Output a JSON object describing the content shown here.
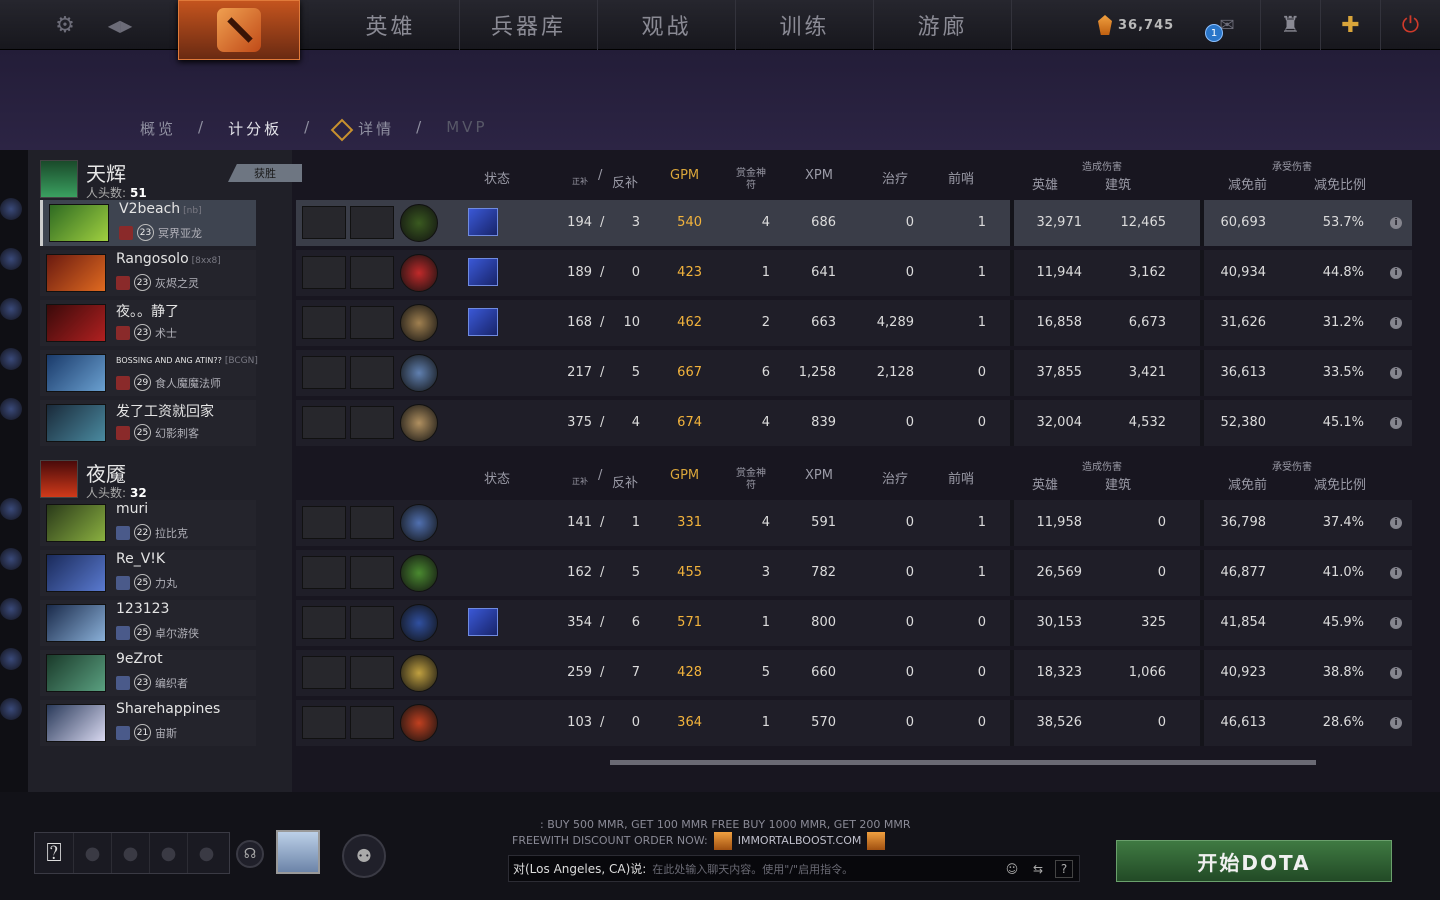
{
  "nav": {
    "items": [
      "英雄",
      "兵器库",
      "观战",
      "训练",
      "游廊"
    ]
  },
  "resources": {
    "shards": "36,745",
    "notifications": "1"
  },
  "subnav": {
    "overview": "概览",
    "scoreboard": "计分板",
    "details": "详情",
    "mvp": "MVP",
    "sep": "/"
  },
  "columns": {
    "status": "状态",
    "kills": "正补",
    "denies": "反补",
    "sep": "/",
    "gpm": "GPM",
    "bounty": "赏金神符",
    "xpm": "XPM",
    "heal": "治疗",
    "wards": "前哨",
    "dmg_dealt": "造成伤害",
    "heroes": "英雄",
    "buildings": "建筑",
    "dmg_taken": "承受伤害",
    "pre_reduction": "减免前",
    "reduction_pct": "减免比例"
  },
  "radiant": {
    "name": "天辉",
    "kills_label": "人头数:",
    "kills": "51",
    "winner": "获胜",
    "players": [
      {
        "name": "V2beach",
        "tag": "[nb]",
        "level": "23",
        "hero": "冥界亚龙",
        "lh": "194",
        "dn": "3",
        "gpm": "540",
        "bounty": "4",
        "xpm": "686",
        "heal": "0",
        "wards": "1",
        "hero_dmg": "32,971",
        "bld_dmg": "12,465",
        "taken": "60,693",
        "pct": "53.7%"
      },
      {
        "name": "Rangosolo",
        "tag": "[8xx8]",
        "level": "23",
        "hero": "灰烬之灵",
        "lh": "189",
        "dn": "0",
        "gpm": "423",
        "bounty": "1",
        "xpm": "641",
        "heal": "0",
        "wards": "1",
        "hero_dmg": "11,944",
        "bld_dmg": "3,162",
        "taken": "40,934",
        "pct": "44.8%"
      },
      {
        "name": "夜。。静了",
        "tag": "",
        "level": "23",
        "hero": "术士",
        "lh": "168",
        "dn": "10",
        "gpm": "462",
        "bounty": "2",
        "xpm": "663",
        "heal": "4,289",
        "wards": "1",
        "hero_dmg": "16,858",
        "bld_dmg": "6,673",
        "taken": "31,626",
        "pct": "31.2%"
      },
      {
        "name": "BOSSING AND ANG ATIN??",
        "tag": "[BCGN]",
        "level": "29",
        "hero": "食人魔魔法师",
        "lh": "217",
        "dn": "5",
        "gpm": "667",
        "bounty": "6",
        "xpm": "1,258",
        "heal": "2,128",
        "wards": "0",
        "hero_dmg": "37,855",
        "bld_dmg": "3,421",
        "taken": "36,613",
        "pct": "33.5%"
      },
      {
        "name": "发了工资就回家",
        "tag": "",
        "level": "25",
        "hero": "幻影刺客",
        "lh": "375",
        "dn": "4",
        "gpm": "674",
        "bounty": "4",
        "xpm": "839",
        "heal": "0",
        "wards": "0",
        "hero_dmg": "32,004",
        "bld_dmg": "4,532",
        "taken": "52,380",
        "pct": "45.1%"
      }
    ]
  },
  "dire": {
    "name": "夜魇",
    "kills_label": "人头数:",
    "kills": "32",
    "players": [
      {
        "name": "muri",
        "level": "22",
        "hero": "拉比克",
        "lh": "141",
        "dn": "1",
        "gpm": "331",
        "bounty": "4",
        "xpm": "591",
        "heal": "0",
        "wards": "1",
        "hero_dmg": "11,958",
        "bld_dmg": "0",
        "taken": "36,798",
        "pct": "37.4%"
      },
      {
        "name": "Re_V!K",
        "level": "25",
        "hero": "力丸",
        "lh": "162",
        "dn": "5",
        "gpm": "455",
        "bounty": "3",
        "xpm": "782",
        "heal": "0",
        "wards": "1",
        "hero_dmg": "26,569",
        "bld_dmg": "0",
        "taken": "46,877",
        "pct": "41.0%"
      },
      {
        "name": "123123",
        "level": "25",
        "hero": "卓尔游侠",
        "lh": "354",
        "dn": "6",
        "gpm": "571",
        "bounty": "1",
        "xpm": "800",
        "heal": "0",
        "wards": "0",
        "hero_dmg": "30,153",
        "bld_dmg": "325",
        "taken": "41,854",
        "pct": "45.9%"
      },
      {
        "name": "9eZrot",
        "level": "23",
        "hero": "编织者",
        "lh": "259",
        "dn": "7",
        "gpm": "428",
        "bounty": "5",
        "xpm": "660",
        "heal": "0",
        "wards": "0",
        "hero_dmg": "18,323",
        "bld_dmg": "1,066",
        "taken": "40,923",
        "pct": "38.8%"
      },
      {
        "name": "Sharehappines",
        "level": "21",
        "hero": "宙斯",
        "lh": "103",
        "dn": "0",
        "gpm": "364",
        "bounty": "1",
        "xpm": "570",
        "heal": "0",
        "wards": "0",
        "hero_dmg": "38,526",
        "bld_dmg": "0",
        "taken": "46,613",
        "pct": "28.6%"
      }
    ]
  },
  "promo": {
    "line1": ": BUY 500 MMR, GET 100 MMR FREE BUY 1000 MMR, GET 200 MMR",
    "line2a": "FREEWITH DISCOUNT ORDER NOW:",
    "line2b": "IMMORTALBOOST.COM"
  },
  "chat": {
    "channel": "对(Los Angeles, CA)说:",
    "placeholder": "在此处输入聊天内容。使用\"/\"启用指令。",
    "help": "?"
  },
  "play_button": "开始DOTA",
  "colors": {
    "gpm": "#f2b33c",
    "play": "#3f7a42",
    "logo": "#c4541e"
  }
}
